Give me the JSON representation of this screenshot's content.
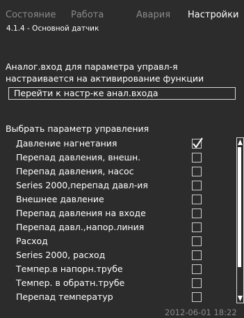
{
  "tabs": [
    {
      "label": "Состояние",
      "active": false
    },
    {
      "label": "Работа",
      "active": false
    },
    {
      "label": "Авария",
      "active": false
    },
    {
      "label": "Настройки",
      "active": true
    }
  ],
  "subtitle": "4.1.4 - Основной датчик",
  "info_lines": [
    "Аналог.вход для параметра управл-я",
    "настраивается на активирование функции"
  ],
  "goto_button": "Перейти к настр-ке анал.входа",
  "list_title": "Выбрать параметр управления",
  "items": [
    {
      "label": "Давление нагнетания",
      "checked": true
    },
    {
      "label": "Перепад давления, внешн.",
      "checked": false
    },
    {
      "label": "Перепад давления, насос",
      "checked": false
    },
    {
      "label": "Series 2000,перепад давл-ия",
      "checked": false
    },
    {
      "label": "Внешнее давление",
      "checked": false
    },
    {
      "label": "Перепад давления на входе",
      "checked": false
    },
    {
      "label": "Перепад давл.,напор.линия",
      "checked": false
    },
    {
      "label": "Расход",
      "checked": false
    },
    {
      "label": "Series 2000, расход",
      "checked": false
    },
    {
      "label": "Темпер.в напорн.трубе",
      "checked": false
    },
    {
      "label": "Темпер. в обратн.трубе",
      "checked": false
    },
    {
      "label": "Перепад температур",
      "checked": false
    }
  ],
  "footer_datetime": "2012-06-01 18:22",
  "colors": {
    "background": "#2c2c2c",
    "text": "#ffffff",
    "inactive": "#8a8a8a"
  }
}
